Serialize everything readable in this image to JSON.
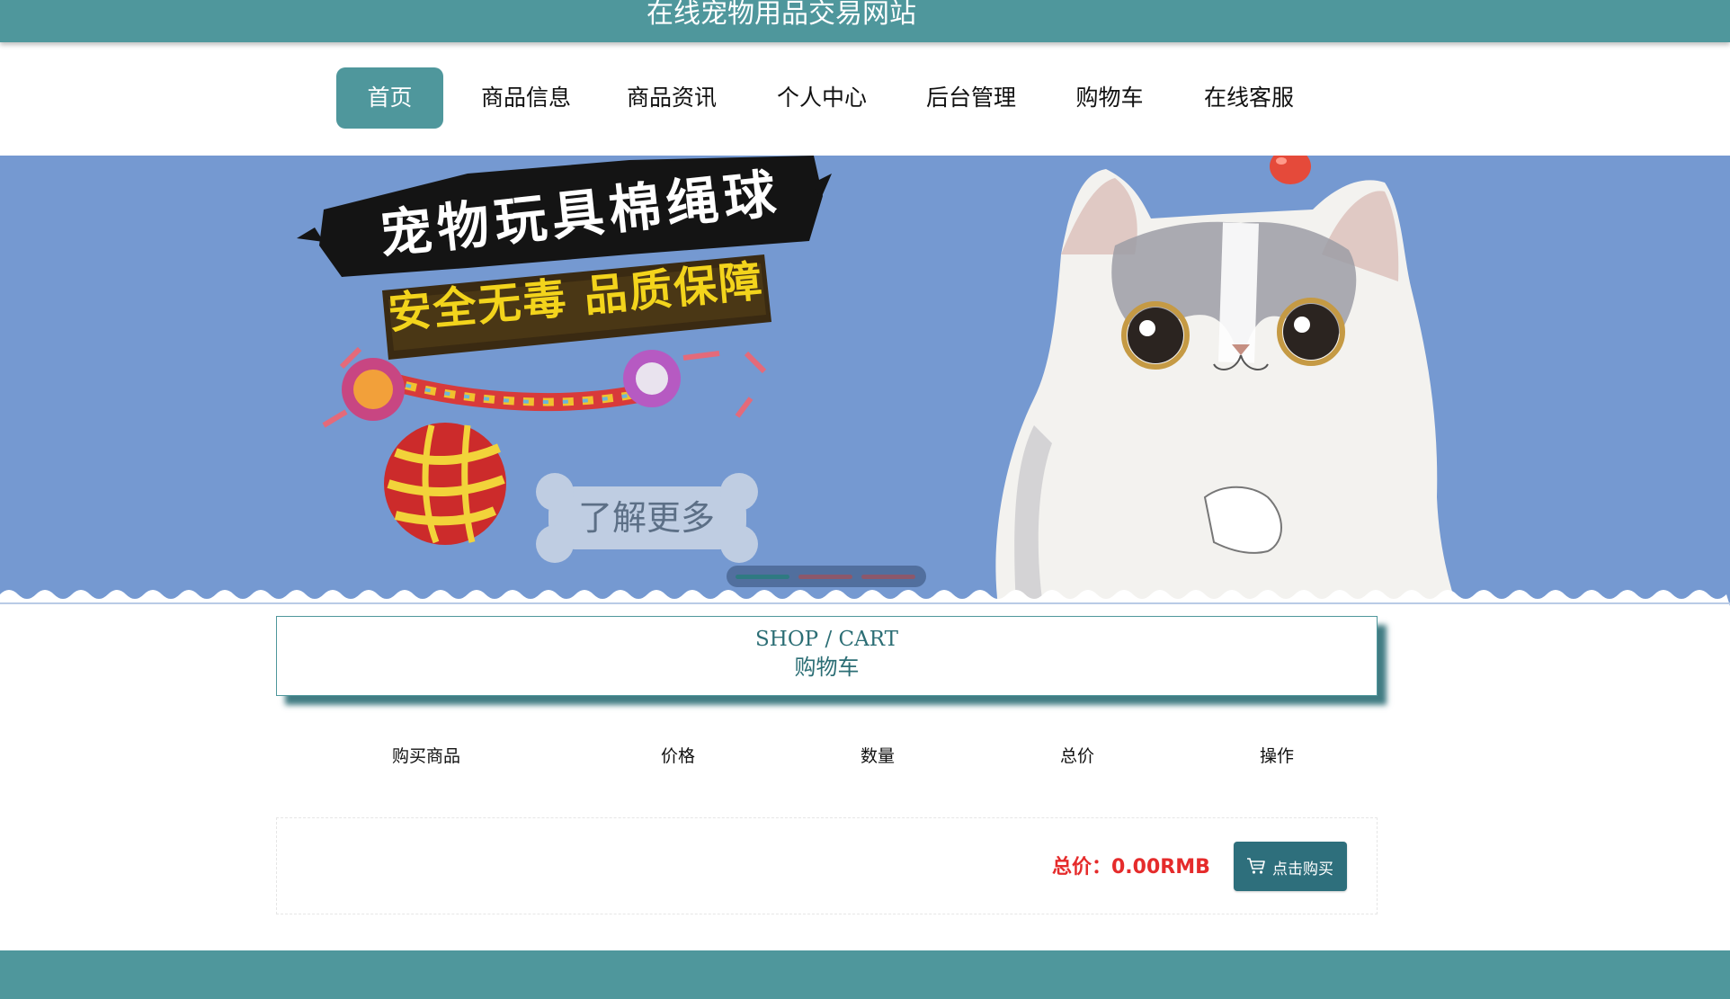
{
  "site": {
    "title": "在线宠物用品交易网站"
  },
  "nav": {
    "items": [
      {
        "label": "首页",
        "active": true
      },
      {
        "label": "商品信息",
        "active": false
      },
      {
        "label": "商品资讯",
        "active": false
      },
      {
        "label": "个人中心",
        "active": false
      },
      {
        "label": "后台管理",
        "active": false
      },
      {
        "label": "购物车",
        "active": false
      },
      {
        "label": "在线客服",
        "active": false
      }
    ]
  },
  "banner": {
    "title": "宠物玩具棉绳球",
    "subtitle": "安全无毒 品质保障",
    "more_label": "了解更多",
    "slides": 3,
    "active_slide": 1
  },
  "section": {
    "title_en": "SHOP / CART",
    "title_cn": "购物车"
  },
  "cart_table": {
    "headers": [
      "购买商品",
      "价格",
      "数量",
      "总价",
      "操作"
    ],
    "rows": []
  },
  "summary": {
    "total_label": "总价：0.00RMB",
    "buy_label": "点击购买"
  },
  "colors": {
    "primary": "#4f979c",
    "button": "#2e6f7c",
    "banner_bg": "#7599d1",
    "total_text": "#e52b2b",
    "heading_text": "#2c6e75"
  }
}
